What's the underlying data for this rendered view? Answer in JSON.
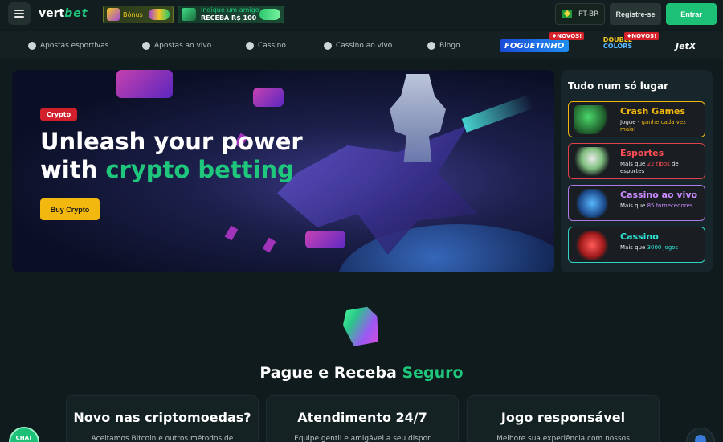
{
  "header": {
    "logo_part1": "vert",
    "logo_part2": "bet",
    "promo_bonus": "Bônus",
    "promo_friend_line1": "Indique um amigo",
    "promo_friend_line2": "RECEBA R$ 100",
    "language": "PT-BR",
    "register_label": "Registre-se",
    "login_label": "Entrar"
  },
  "nav": {
    "items": [
      {
        "label": "Apostas esportivas"
      },
      {
        "label": "Apostas ao vivo"
      },
      {
        "label": "Cassino"
      },
      {
        "label": "Cassino ao vivo"
      },
      {
        "label": "Bingo"
      }
    ],
    "brands": {
      "foguetinho": "FOGUETINHO",
      "double_line1": "DOUBLE",
      "double_line2": "COLORS",
      "jetx": "JetX"
    },
    "new_badge": "♦NOVOS!"
  },
  "hero": {
    "tag": "Crypto",
    "title_line1": "Unleash your power",
    "title_line2_prefix": "with ",
    "title_line2_accent": "crypto betting",
    "button_label": "Buy Crypto"
  },
  "side": {
    "title": "Tudo num só lugar",
    "cards": [
      {
        "title": "Crash Games",
        "sub_prefix": "Jogue - ",
        "sub_highlight": "ganhe cada vez mais!",
        "sub_suffix": ""
      },
      {
        "title": "Esportes",
        "sub_prefix": "Mais que ",
        "sub_highlight": "22 tipos",
        "sub_suffix": " de esportes"
      },
      {
        "title": "Cassino ao vivo",
        "sub_prefix": "Mais que ",
        "sub_highlight": "85 fornecedores",
        "sub_suffix": ""
      },
      {
        "title": "Cassino",
        "sub_prefix": "Mais que ",
        "sub_highlight": "3000 jogos",
        "sub_suffix": ""
      }
    ]
  },
  "section": {
    "title_prefix": "Pague e Receba ",
    "title_accent": "Seguro",
    "features": [
      {
        "title": "Novo nas criptomoedas?",
        "desc": "Aceitamos Bitcoin e outros métodos de"
      },
      {
        "title": "Atendimento 24/7",
        "desc": "Equipe gentil e amigável a seu dispor"
      },
      {
        "title": "Jogo responsável",
        "desc": "Melhore sua experiência com nossos"
      }
    ]
  },
  "chat_label": "CHAT"
}
